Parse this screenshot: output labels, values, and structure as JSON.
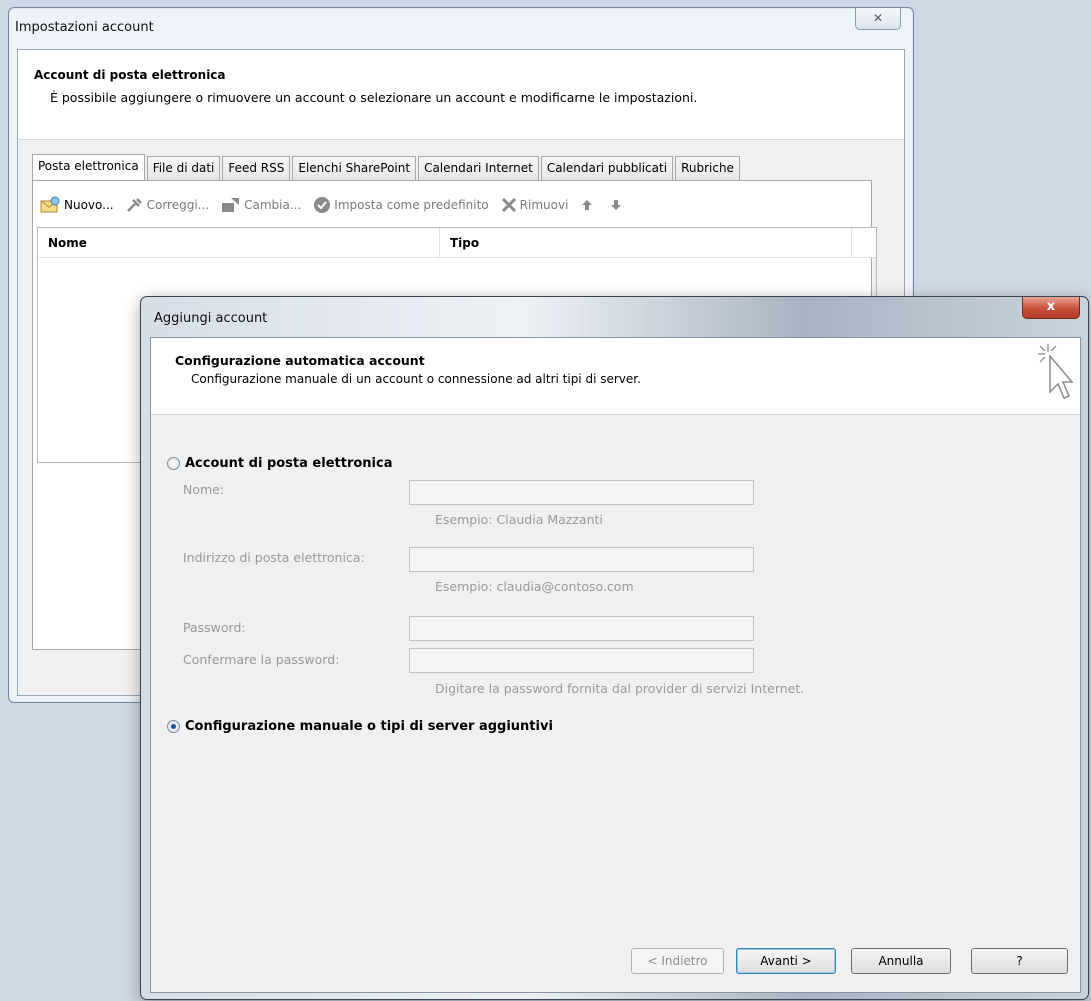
{
  "back_window": {
    "title": "Impostazioni account",
    "close_glyph": "✕",
    "header_title": "Account di posta elettronica",
    "header_subtitle": "È possibile aggiungere o rimuovere un account o selezionare un account e modificarne le impostazioni.",
    "tabs": [
      {
        "label": "Posta elettronica",
        "active": true
      },
      {
        "label": "File di dati"
      },
      {
        "label": "Feed RSS"
      },
      {
        "label": "Elenchi SharePoint"
      },
      {
        "label": "Calendari Internet"
      },
      {
        "label": "Calendari pubblicati"
      },
      {
        "label": "Rubriche"
      }
    ],
    "toolbar": {
      "new": "Nuovo...",
      "repair": "Correggi...",
      "change": "Cambia...",
      "set_default": "Imposta come predefinito",
      "remove": "Rimuovi"
    },
    "list_columns": [
      "Nome",
      "Tipo"
    ]
  },
  "front_window": {
    "title": "Aggiungi account",
    "close_glyph": "x",
    "header_title": "Configurazione automatica account",
    "header_subtitle": "Configurazione manuale di un account o connessione ad altri tipi di server.",
    "option_email": "Account di posta elettronica",
    "option_email_checked": false,
    "fields": {
      "name_label": "Nome:",
      "name_hint": "Esempio: Claudia Mazzanti",
      "email_label": "Indirizzo di posta elettronica:",
      "email_hint": "Esempio: claudia@contoso.com",
      "password_label": "Password:",
      "confirm_label": "Confermare la password:",
      "password_hint": "Digitare la password fornita dal provider di servizi Internet."
    },
    "option_manual": "Configurazione manuale o tipi di server aggiuntivi",
    "option_manual_checked": true,
    "buttons": {
      "back": "< Indietro",
      "next": "Avanti >",
      "cancel": "Annulla",
      "help": "?"
    }
  }
}
